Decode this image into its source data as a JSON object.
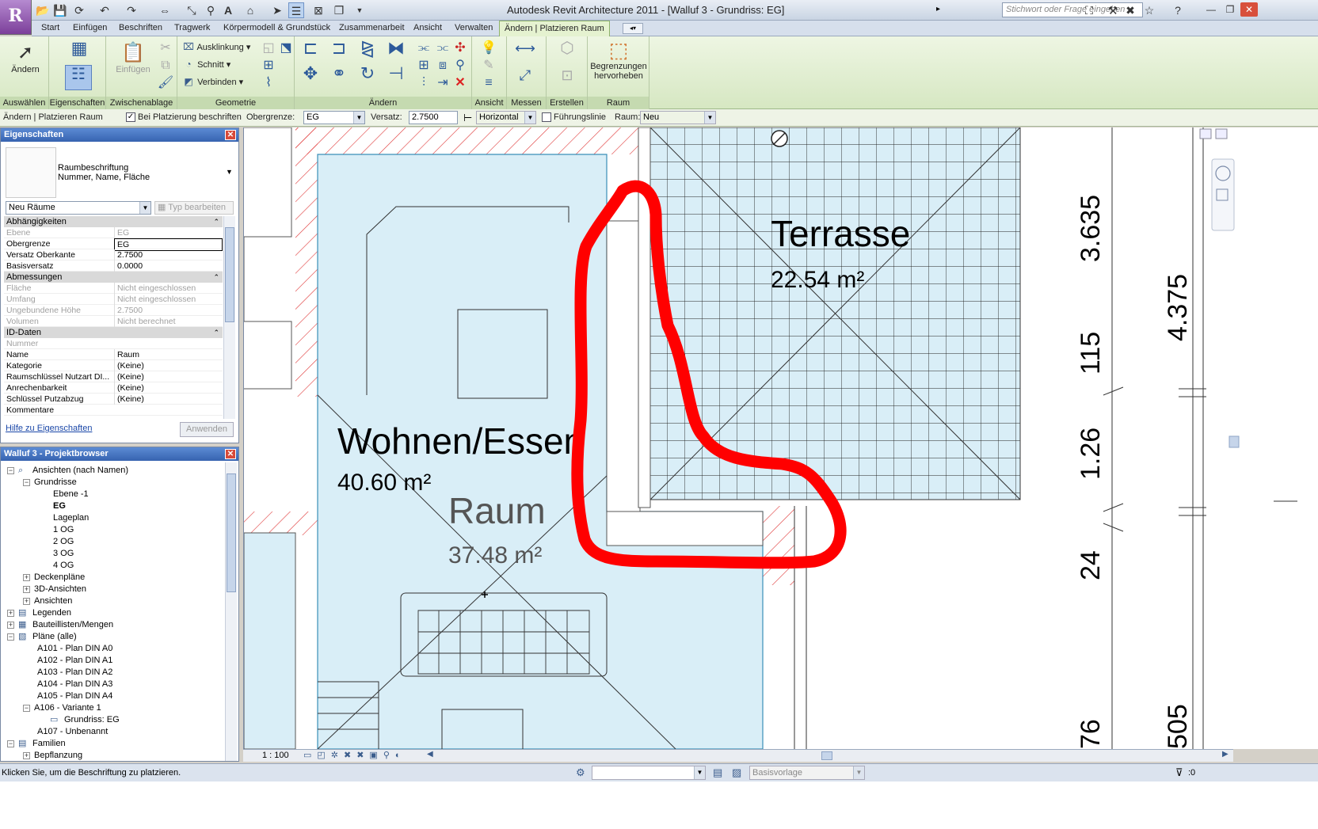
{
  "title_bar": {
    "app_button": "R",
    "title": "Autodesk Revit Architecture 2011 - [Walluf 3 - Grundriss: EG]",
    "search_placeholder": "Stichwort oder Frage eingeben",
    "search_arrow": "▸"
  },
  "tabs": [
    "Start",
    "Einfügen",
    "Beschriften",
    "Tragwerk",
    "Körpermodell & Grundstück",
    "Zusammenarbeit",
    "Ansicht",
    "Verwalten",
    "Ändern | Platzieren Raum"
  ],
  "ribbon": {
    "aendern_label": "Ändern",
    "einfuegen_label": "Einfügen",
    "ausklinkung": "Ausklinkung",
    "schnitt": "Schnitt",
    "verbinden": "Verbinden",
    "begrenzungen": "Begrenzungen hervorheben",
    "panels": {
      "auswaehlen": "Auswählen",
      "eigenschaften": "Eigenschaften",
      "zwischenablage": "Zwischenablage",
      "geometrie": "Geometrie",
      "aendern": "Ändern",
      "ansicht": "Ansicht",
      "messen": "Messen",
      "erstellen": "Erstellen",
      "raum": "Raum"
    }
  },
  "options_bar": {
    "context": "Ändern | Platzieren Raum",
    "tag_on_place": "Bei Platzierung beschriften",
    "upper_limit_label": "Obergrenze:",
    "upper_limit_value": "EG",
    "offset_label": "Versatz:",
    "offset_value": "2.7500",
    "orientation": "Horizontal",
    "leader": "Führungslinie",
    "room_label": "Raum:",
    "room_value": "Neu"
  },
  "properties": {
    "title": "Eigenschaften",
    "type_name": "Raumbeschriftung",
    "type_sub": "Nummer, Name, Fläche",
    "filter": "Neu Räume",
    "edit_type": "Typ bearbeiten",
    "groups": [
      {
        "name": "Abhängigkeiten",
        "rows": [
          {
            "n": "Ebene",
            "v": "EG",
            "dis": true
          },
          {
            "n": "Obergrenze",
            "v": "EG",
            "dis": false
          },
          {
            "n": "Versatz Oberkante",
            "v": "2.7500",
            "dis": false
          },
          {
            "n": "Basisversatz",
            "v": "0.0000",
            "dis": false
          }
        ]
      },
      {
        "name": "Abmessungen",
        "rows": [
          {
            "n": "Fläche",
            "v": "Nicht eingeschlossen",
            "dis": true
          },
          {
            "n": "Umfang",
            "v": "Nicht eingeschlossen",
            "dis": true
          },
          {
            "n": "Ungebundene Höhe",
            "v": "2.7500",
            "dis": true
          },
          {
            "n": "Volumen",
            "v": "Nicht berechnet",
            "dis": true
          }
        ]
      },
      {
        "name": "ID-Daten",
        "rows": [
          {
            "n": "Nummer",
            "v": "",
            "dis": true
          },
          {
            "n": "Name",
            "v": "Raum",
            "dis": false
          },
          {
            "n": "Kategorie",
            "v": "(Keine)",
            "dis": false
          },
          {
            "n": "Raumschlüssel Nutzart DI...",
            "v": "(Keine)",
            "dis": false
          },
          {
            "n": "Anrechenbarkeit",
            "v": "(Keine)",
            "dis": false
          },
          {
            "n": "Schlüssel Putzabzug",
            "v": "(Keine)",
            "dis": false
          },
          {
            "n": "Kommentare",
            "v": "",
            "dis": false
          }
        ]
      }
    ],
    "help_link": "Hilfe zu Eigenschaften",
    "apply": "Anwenden"
  },
  "project_browser": {
    "title": "Walluf 3 - Projektbrowser",
    "items": [
      {
        "label": "Ansichten (nach Namen)",
        "level": 0,
        "exp": "−",
        "icon": "views",
        "bold": false
      },
      {
        "label": "Grundrisse",
        "level": 1,
        "exp": "−",
        "icon": "",
        "bold": false
      },
      {
        "label": "Ebene -1",
        "level": 2,
        "exp": "",
        "icon": "",
        "bold": false
      },
      {
        "label": "EG",
        "level": 2,
        "exp": "",
        "icon": "",
        "bold": true
      },
      {
        "label": "Lageplan",
        "level": 2,
        "exp": "",
        "icon": "",
        "bold": false
      },
      {
        "label": "1 OG",
        "level": 2,
        "exp": "",
        "icon": "",
        "bold": false
      },
      {
        "label": "2 OG",
        "level": 2,
        "exp": "",
        "icon": "",
        "bold": false
      },
      {
        "label": "3 OG",
        "level": 2,
        "exp": "",
        "icon": "",
        "bold": false
      },
      {
        "label": "4 OG",
        "level": 2,
        "exp": "",
        "icon": "",
        "bold": false
      },
      {
        "label": "Deckenpläne",
        "level": 1,
        "exp": "+",
        "icon": "",
        "bold": false
      },
      {
        "label": "3D-Ansichten",
        "level": 1,
        "exp": "+",
        "icon": "",
        "bold": false
      },
      {
        "label": "Ansichten",
        "level": 1,
        "exp": "+",
        "icon": "",
        "bold": false
      },
      {
        "label": "Legenden",
        "level": 0,
        "exp": "+",
        "icon": "legend",
        "bold": false
      },
      {
        "label": "Bauteillisten/Mengen",
        "level": 0,
        "exp": "+",
        "icon": "table",
        "bold": false
      },
      {
        "label": "Pläne (alle)",
        "level": 0,
        "exp": "−",
        "icon": "sheet",
        "bold": false
      },
      {
        "label": "A101 - Plan DIN A0",
        "level": 1,
        "exp": "",
        "icon": "",
        "bold": false
      },
      {
        "label": "A102 - Plan DIN A1",
        "level": 1,
        "exp": "",
        "icon": "",
        "bold": false
      },
      {
        "label": "A103 - Plan DIN A2",
        "level": 1,
        "exp": "",
        "icon": "",
        "bold": false
      },
      {
        "label": "A104 - Plan DIN A3",
        "level": 1,
        "exp": "",
        "icon": "",
        "bold": false
      },
      {
        "label": "A105 - Plan DIN A4",
        "level": 1,
        "exp": "",
        "icon": "",
        "bold": false
      },
      {
        "label": "A106 - Variante 1",
        "level": 1,
        "exp": "−",
        "icon": "",
        "bold": false
      },
      {
        "label": "Grundriss: EG",
        "level": 2,
        "exp": "",
        "icon": "viewport",
        "bold": false
      },
      {
        "label": "A107 - Unbenannt",
        "level": 1,
        "exp": "",
        "icon": "",
        "bold": false
      },
      {
        "label": "Familien",
        "level": 0,
        "exp": "−",
        "icon": "family",
        "bold": false
      },
      {
        "label": "Bepflanzung",
        "level": 1,
        "exp": "+",
        "icon": "",
        "bold": false
      }
    ]
  },
  "drawing": {
    "room1_name": "Wohnen/Essen",
    "room1_area": "40.60 m²",
    "room2_name": "Raum",
    "room2_area": "37.48 m²",
    "room3_name": "Terrasse",
    "room3_area": "22.54 m²",
    "dims": [
      "3.635",
      "4.375",
      "115",
      "1.26",
      "24",
      "76",
      "505"
    ],
    "highlight_color": "#ff0000",
    "room_fill": "#d9eef7",
    "hatch_color": "#e03030"
  },
  "view_bar": {
    "scale": "1 : 100"
  },
  "status_bar": {
    "message": "Klicken Sie, um die Beschriftung zu platzieren.",
    "workset": "Basisvorlage",
    "filter_count": ":0"
  }
}
